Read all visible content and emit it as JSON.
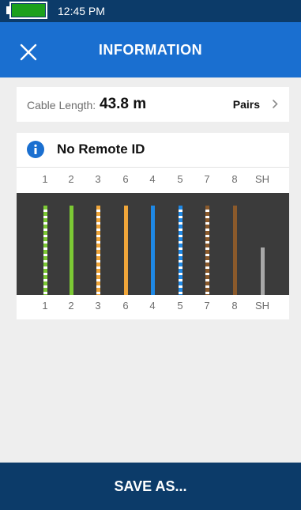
{
  "status_bar": {
    "time": "12:45 PM"
  },
  "app_bar": {
    "title": "INFORMATION",
    "close_icon": "close-icon"
  },
  "cable": {
    "length_label": "Cable Length:",
    "length_value": "43.8 m",
    "pairs_label": "Pairs",
    "pairs_icon": "chevron-right-icon"
  },
  "remote": {
    "title": "No Remote ID",
    "icon": "info-icon"
  },
  "pins_top": [
    "1",
    "2",
    "3",
    "6",
    "4",
    "5",
    "7",
    "8",
    "SH"
  ],
  "pins_bottom": [
    "1",
    "2",
    "3",
    "6",
    "4",
    "5",
    "7",
    "8",
    "SH"
  ],
  "wires": [
    {
      "pin": "1",
      "color": "#7cc934",
      "striped": true,
      "level": 1.0
    },
    {
      "pin": "2",
      "color": "#7cc934",
      "striped": false,
      "level": 1.0
    },
    {
      "pin": "3",
      "color": "#f0a63a",
      "striped": true,
      "level": 1.0
    },
    {
      "pin": "6",
      "color": "#f0a63a",
      "striped": false,
      "level": 1.0
    },
    {
      "pin": "4",
      "color": "#1e88e5",
      "striped": false,
      "level": 1.0
    },
    {
      "pin": "5",
      "color": "#1e88e5",
      "striped": true,
      "level": 1.0
    },
    {
      "pin": "7",
      "color": "#8b5a2b",
      "striped": true,
      "level": 1.0
    },
    {
      "pin": "8",
      "color": "#8b5a2b",
      "striped": false,
      "level": 1.0
    },
    {
      "pin": "SH",
      "color": "#a8a8a8",
      "striped": false,
      "level": 0.53
    }
  ],
  "footer": {
    "save_label": "SAVE AS..."
  },
  "colors": {
    "status_bar": "#0c3b69",
    "app_bar": "#1a6fd0",
    "footer": "#0c3b69",
    "battery": "#1ca01c",
    "background": "#eeeeee",
    "wire_panel": "#3b3b3b"
  }
}
